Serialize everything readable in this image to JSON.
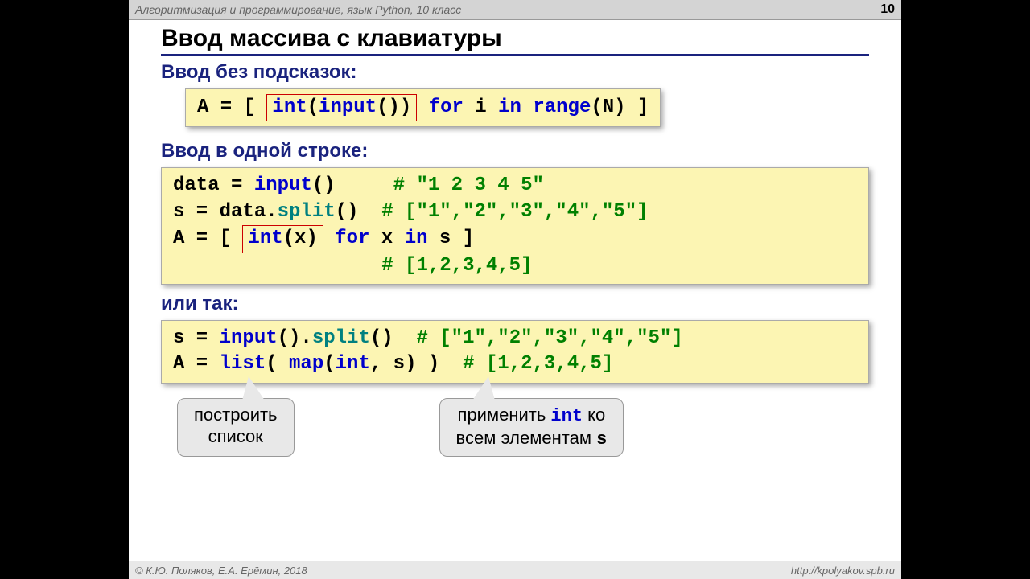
{
  "header": {
    "breadcrumb": "Алгоритмизация и программирование, язык Python, 10 класс",
    "page": "10"
  },
  "title": "Ввод массива с клавиатуры",
  "sec1": {
    "heading": "Ввод без подсказок:"
  },
  "code1": {
    "p1": "A = [ ",
    "box": "int(input())",
    "p2": " for i in range(N) ]",
    "kw_int": "int",
    "kw_input": "input",
    "kw_for": "for",
    "kw_in": "in",
    "kw_range": "range"
  },
  "sec2": {
    "heading": "Ввод в одной строке:"
  },
  "code2": {
    "l1a": "data = ",
    "l1b": "input",
    "l1c": "()     ",
    "l1d": "# \"1 2 3 4 5\"",
    "l2a": "s = data.",
    "l2b": "split",
    "l2c": "()  ",
    "l2d": "# [\"1\",\"2\",\"3\",\"4\",\"5\"]",
    "l3a": "A = [ ",
    "l3box_int": "int",
    "l3box_rest": "(x)",
    "l3b": " for x in s ]",
    "l3_for": "for",
    "l3_in": "in",
    "l4pad": "                  ",
    "l4": "# [1,2,3,4,5]"
  },
  "sec3": {
    "heading": "или так:"
  },
  "code3": {
    "l1a": "s = ",
    "l1_input": "input",
    "l1b": "().",
    "l1_split": "split",
    "l1c": "()  ",
    "l1d": "# [\"1\",\"2\",\"3\",\"4\",\"5\"]",
    "l2a": "A = ",
    "l2_list": "list",
    "l2b": "( ",
    "l2_map": "map",
    "l2c": "(",
    "l2_int": "int",
    "l2d": ", s) )  ",
    "l2e": "# [1,2,3,4,5]"
  },
  "callouts": {
    "c1_l1": "построить",
    "c1_l2": "список",
    "c2_l1a": "применить ",
    "c2_int": "int",
    "c2_l1b": " ко",
    "c2_l2a": "всем элементам ",
    "c2_s": "s"
  },
  "footer": {
    "left": "© К.Ю. Поляков, Е.А. Ерёмин, 2018",
    "right": "http://kpolyakov.spb.ru"
  }
}
